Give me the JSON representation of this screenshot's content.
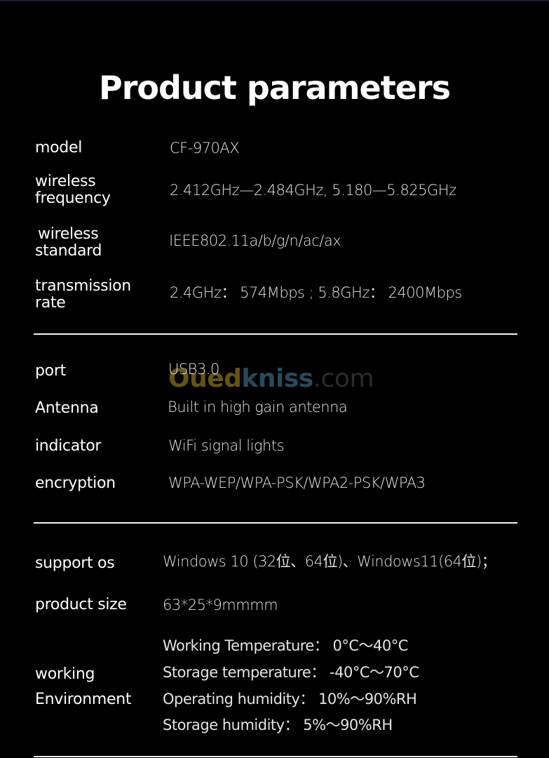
{
  "title": "Product parameters",
  "watermark": {
    "part1": "Oued",
    "part2": "kniss",
    "part3": ".com",
    "colors": {
      "part1": "#6b5a12",
      "part2": "#2a4e62",
      "part3": "#2e2e2e"
    }
  },
  "section1": [
    {
      "label": "model",
      "value": "CF-970AX"
    },
    {
      "label_line1": "wireless",
      "label_line2": "frequency",
      "value": "2.412GHz—2.484GHz,  5.180—5.825GHz"
    },
    {
      "label_line1": "wireless",
      "label_line2": "standard",
      "value": "IEEE802.11a/b/g/n/ac/ax"
    },
    {
      "label_line1": "transmission",
      "label_line2": "rate",
      "value": "2.4GHz：  574Mbps ; 5.8GHz：  2400Mbps"
    }
  ],
  "section2": [
    {
      "label": "port",
      "value": "USB3.0"
    },
    {
      "label": "Antenna",
      "value": "Built in high gain antenna"
    },
    {
      "label": "indicator",
      "value": "WiFi signal lights"
    },
    {
      "label": "encryption",
      "value": "WPA-WEP/WPA-PSK/WPA2-PSK/WPA3"
    }
  ],
  "section3": {
    "support_os": {
      "label": "support os",
      "value": "Windows 10 (32位、64位)、Windows11(64位)；"
    },
    "product_size": {
      "label": "product size",
      "value": "63*25*9mmmm"
    },
    "environment": {
      "label_line1": "working",
      "label_line2": "Environment",
      "lines": [
        "Working Temperature：  0°C～40°C",
        "Storage temperature：  -40°C～70°C",
        "Operating humidity：  10%～90%RH",
        "Storage humidity：  5%～90%RH"
      ]
    }
  }
}
